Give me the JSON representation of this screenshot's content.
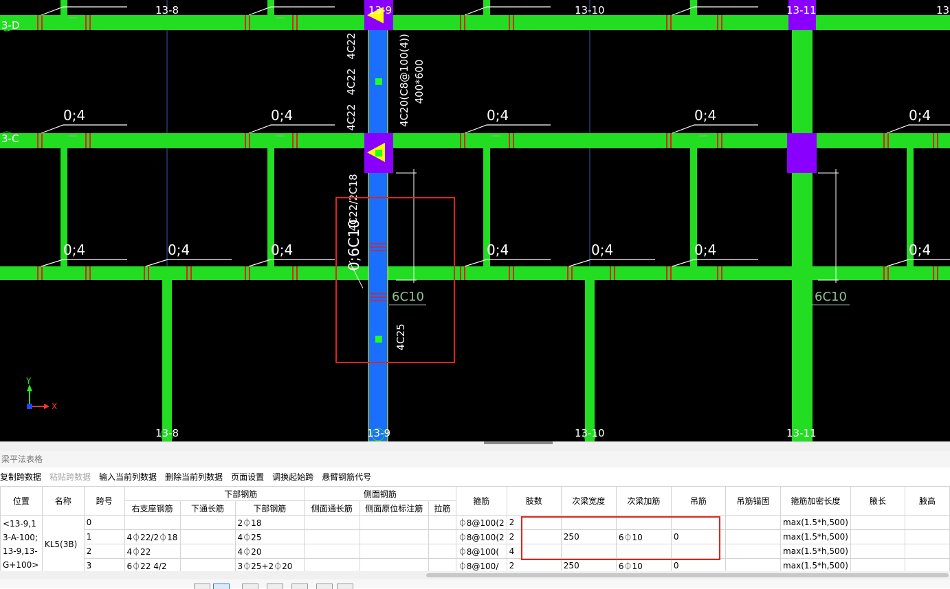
{
  "canvas": {
    "axis_top": [
      "13-8",
      "13-9",
      "13-10",
      "13-11",
      "13"
    ],
    "axis_bottom": [
      "13-8",
      "13-9",
      "13-10",
      "13-11"
    ],
    "axis_left": [
      "3-D",
      "3-C"
    ],
    "beam_marks": [
      "0;4",
      "0;4",
      "0;4",
      "0;4",
      "0;4",
      "0;4",
      "0;4",
      "0;4",
      "0;4",
      "0;4",
      "0;4",
      "0;4"
    ],
    "selected_beam": {
      "top_bars_1": "4C22",
      "top_bars_2": "4C22",
      "top_bars_3": "4C22",
      "stirrup": "4C20(C8@100(4))",
      "section": "400*600",
      "support_bars": "4C22/2C18",
      "bottom_bars": "4C25",
      "hanger_mark": "0;6C10",
      "hanger_label": "6C10"
    },
    "hanger_label_right": "6C10",
    "ucs": {
      "y": "Y",
      "x": "X"
    },
    "colors": {
      "beam": "#22dd22",
      "selected": "#1a6fff",
      "column": "#8a00ff",
      "axis_line": "#3a5aa8",
      "rebar": "#e02020"
    }
  },
  "panel": {
    "title": "梁平法表格",
    "toolbar": [
      "复制跨数据",
      "粘贴跨数据",
      "输入当前列数据",
      "删除当前列数据",
      "页面设置",
      "调换起始跨",
      "悬臂钢筋代号"
    ]
  },
  "table": {
    "h_position": "位置",
    "h_name": "名称",
    "h_span": "跨号",
    "h_bottom_group": "下部钢筋",
    "h_side_group": "侧面钢筋",
    "h_stirrup": "箍筋",
    "h_legs": "肢数",
    "h_sec_width": "次梁宽度",
    "h_sec_add": "次梁加筋",
    "h_hanger": "吊筋",
    "h_hanger_anchor": "吊筋锚固",
    "h_dense_len": "箍筋加密长度",
    "h_haunch_len": "腋长",
    "h_haunch_h": "腋高",
    "sub_right_support": "右支座钢筋",
    "sub_bottom_through": "下通长筋",
    "sub_bottom_bars": "下部钢筋",
    "sub_side_through": "侧面通长筋",
    "sub_side_orig": "侧面原位标注筋",
    "sub_tie": "拉筋",
    "position_text": "<13-9,13-A-100;13-9,13-G+100>",
    "name_text": "KL5(3B)",
    "rows": [
      {
        "span": "0",
        "right": "",
        "bthrough": "",
        "bottom": "2⏀18",
        "sthrough": "",
        "sorig": "",
        "tie": "",
        "stirrup": "⏀8@100(2",
        "legs": "2",
        "sw": "",
        "sadd": "",
        "hanger": "",
        "anchor": "",
        "dense": "max(1.5*h,500)"
      },
      {
        "span": "1",
        "right": "4⏀22/2⏀18",
        "bthrough": "",
        "bottom": "4⏀25",
        "sthrough": "",
        "sorig": "",
        "tie": "",
        "stirrup": "⏀8@100(2",
        "legs": "2",
        "sw": "250",
        "sadd": "6⏀10",
        "hanger": "0",
        "anchor": "",
        "dense": "max(1.5*h,500)"
      },
      {
        "span": "2",
        "right": "4⏀22",
        "bthrough": "",
        "bottom": "4⏀20",
        "sthrough": "",
        "sorig": "",
        "tie": "",
        "stirrup": "⏀8@100(",
        "legs": "4",
        "sw": "",
        "sadd": "",
        "hanger": "",
        "anchor": "",
        "dense": "max(1.5*h,500)"
      },
      {
        "span": "3",
        "right": "6⏀22 4/2",
        "bthrough": "",
        "bottom": "3⏀25+2⏀20",
        "sthrough": "",
        "sorig": "",
        "tie": "",
        "stirrup": "⏀8@100/",
        "legs": "2",
        "sw": "250",
        "sadd": "6⏀10",
        "hanger": "0",
        "anchor": "",
        "dense": "max(1.5*h,500)"
      }
    ]
  }
}
